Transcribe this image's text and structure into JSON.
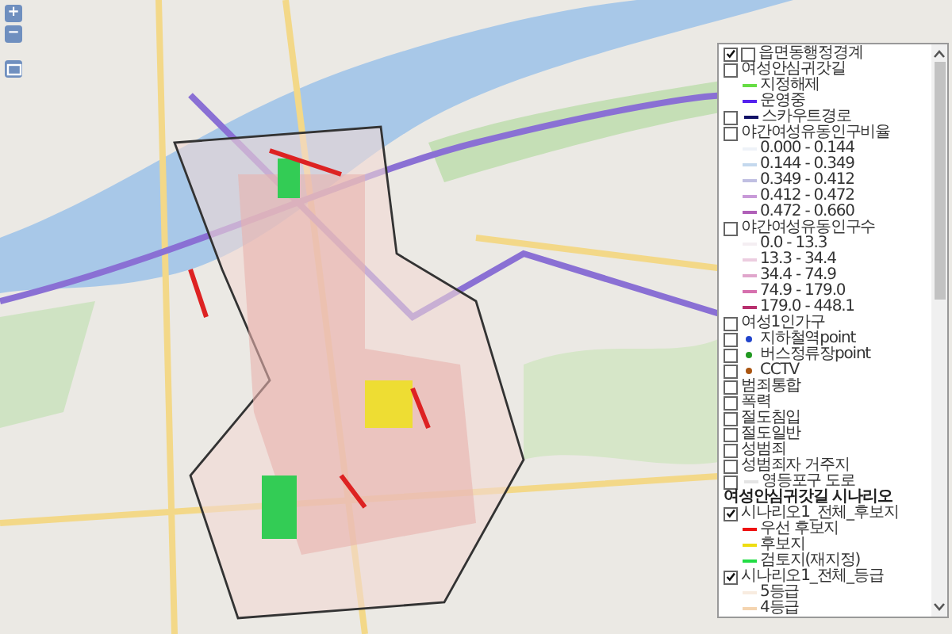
{
  "zoom_controls": [
    {
      "label": "+"
    },
    {
      "label": "−"
    }
  ],
  "layers": [
    {
      "kind": "layer",
      "label": "읍면동행정경계",
      "checkboxes": [
        {
          "checked": true
        },
        {
          "checked": false
        }
      ]
    },
    {
      "kind": "layer",
      "label": "여성안심귀갓길",
      "checkboxes": [
        {
          "checked": false
        }
      ],
      "children": [
        {
          "label": "지정해제",
          "color": "#66dd44"
        },
        {
          "label": "운영중",
          "color": "#5522ee"
        }
      ]
    },
    {
      "kind": "layer",
      "label": "스카우트경로",
      "checkboxes": [
        {
          "checked": false
        }
      ],
      "symbol": {
        "kind": "line",
        "color": "#111166"
      }
    },
    {
      "kind": "layer",
      "label": "야간여성유동인구비율",
      "checkboxes": [
        {
          "checked": false
        }
      ],
      "children": [
        {
          "label": "0.000 - 0.144",
          "color": "#eef2f8"
        },
        {
          "label": "0.144 - 0.349",
          "color": "#c4d8ee"
        },
        {
          "label": "0.349 - 0.412",
          "color": "#c0bfe2"
        },
        {
          "label": "0.412 - 0.472",
          "color": "#c89ad8"
        },
        {
          "label": "0.472 - 0.660",
          "color": "#b060b8"
        }
      ]
    },
    {
      "kind": "layer",
      "label": "야간여성유동인구수",
      "checkboxes": [
        {
          "checked": false
        }
      ],
      "children": [
        {
          "label": "0.0 - 13.3",
          "color": "#f4eef2"
        },
        {
          "label": "13.3 - 34.4",
          "color": "#eccde0"
        },
        {
          "label": "34.4 - 74.9",
          "color": "#e0a6cc"
        },
        {
          "label": "74.9 - 179.0",
          "color": "#d670ae"
        },
        {
          "label": "179.0 - 448.1",
          "color": "#b8306e"
        }
      ]
    },
    {
      "kind": "layer",
      "label": "여성1인가구",
      "checkboxes": [
        {
          "checked": false
        }
      ]
    },
    {
      "kind": "layer",
      "label": "지하철역point",
      "checkboxes": [
        {
          "checked": false
        }
      ],
      "symbol": {
        "kind": "dot",
        "color": "#2244cc"
      }
    },
    {
      "kind": "layer",
      "label": "버스정류장point",
      "checkboxes": [
        {
          "checked": false
        }
      ],
      "symbol": {
        "kind": "dot",
        "color": "#229922"
      }
    },
    {
      "kind": "layer",
      "label": "CCTV",
      "checkboxes": [
        {
          "checked": false
        }
      ],
      "symbol": {
        "kind": "dot",
        "color": "#aa5511"
      }
    },
    {
      "kind": "layer",
      "label": "범죄통합",
      "checkboxes": [
        {
          "checked": false
        }
      ]
    },
    {
      "kind": "layer",
      "label": "폭력",
      "checkboxes": [
        {
          "checked": false
        }
      ]
    },
    {
      "kind": "layer",
      "label": "절도침입",
      "checkboxes": [
        {
          "checked": false
        }
      ]
    },
    {
      "kind": "layer",
      "label": "절도일반",
      "checkboxes": [
        {
          "checked": false
        }
      ]
    },
    {
      "kind": "layer",
      "label": "성범죄",
      "checkboxes": [
        {
          "checked": false
        }
      ]
    },
    {
      "kind": "layer",
      "label": "성범죄자 거주지",
      "checkboxes": [
        {
          "checked": false
        }
      ]
    },
    {
      "kind": "layer",
      "label": "영등포구 도로",
      "checkboxes": [
        {
          "checked": false
        }
      ],
      "symbol": {
        "kind": "line",
        "color": "#e4e4e4"
      }
    },
    {
      "kind": "heading",
      "label": "여성안심귀갓길 시나리오"
    },
    {
      "kind": "layer",
      "label": "시나리오1_전체_후보지",
      "checkboxes": [
        {
          "checked": true
        }
      ],
      "children": [
        {
          "label": "우선 후보지",
          "color": "#ee1111"
        },
        {
          "label": "후보지",
          "color": "#eedd11"
        },
        {
          "label": "검토지(재지정)",
          "color": "#22dd44"
        }
      ]
    },
    {
      "kind": "layer",
      "label": "시나리오1_전체_등급",
      "checkboxes": [
        {
          "checked": true
        }
      ],
      "children": [
        {
          "label": "5등급",
          "color": "#f8ece0"
        },
        {
          "label": "4등급",
          "color": "#f4d4b0"
        }
      ]
    }
  ]
}
